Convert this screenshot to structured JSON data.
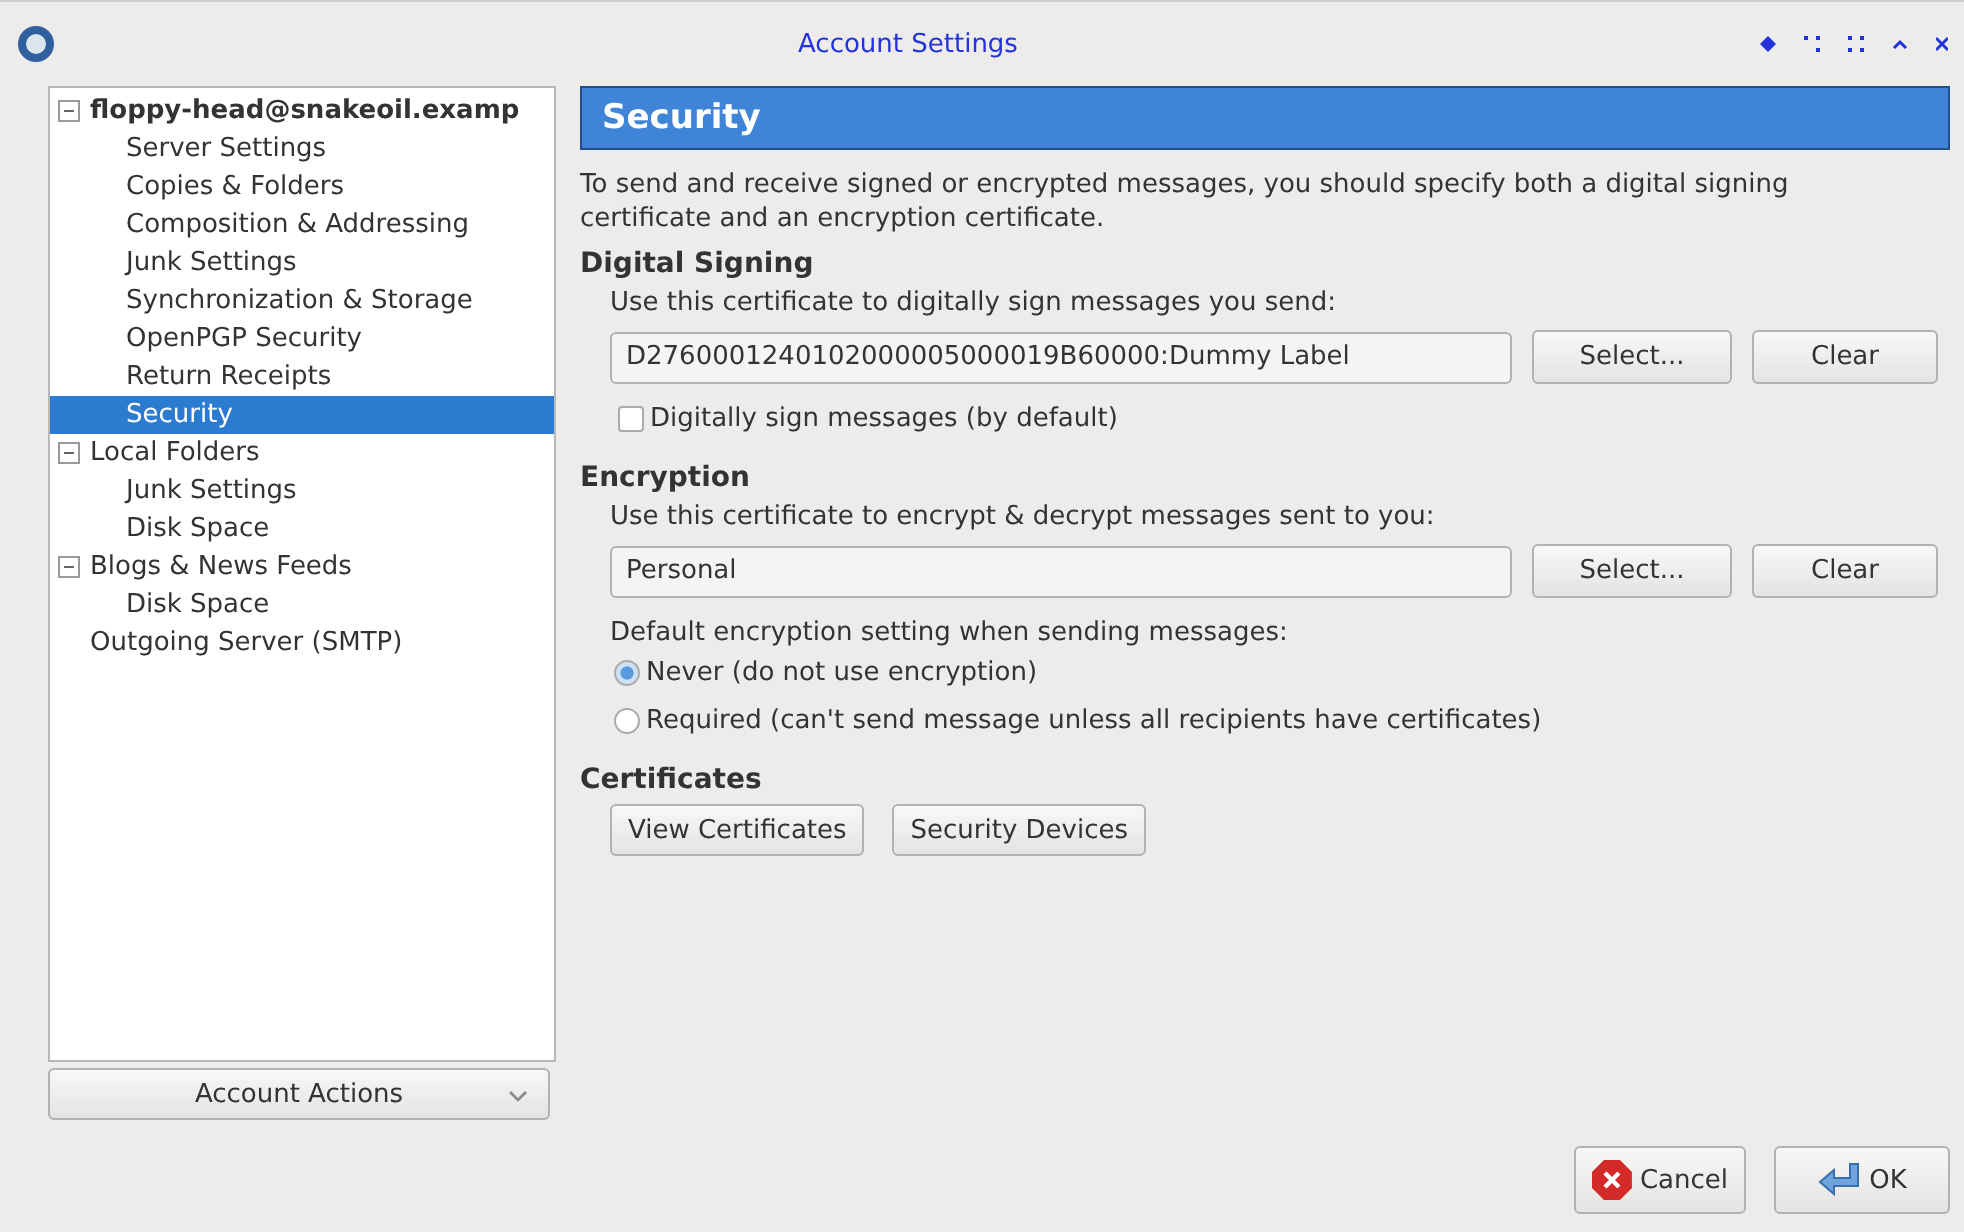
{
  "window": {
    "title": "Account Settings"
  },
  "tree": [
    {
      "label": "floppy-head@snakeoil.examp",
      "selected": false,
      "expanded": true,
      "bold": true,
      "children": [
        {
          "label": "Server Settings",
          "selected": false
        },
        {
          "label": "Copies & Folders",
          "selected": false
        },
        {
          "label": "Composition & Addressing",
          "selected": false
        },
        {
          "label": "Junk Settings",
          "selected": false
        },
        {
          "label": "Synchronization & Storage",
          "selected": false
        },
        {
          "label": "OpenPGP Security",
          "selected": false
        },
        {
          "label": "Return Receipts",
          "selected": false
        },
        {
          "label": "Security",
          "selected": true
        }
      ]
    },
    {
      "label": "Local Folders",
      "selected": false,
      "expanded": true,
      "children": [
        {
          "label": "Junk Settings",
          "selected": false
        },
        {
          "label": "Disk Space",
          "selected": false
        }
      ]
    },
    {
      "label": "Blogs & News Feeds",
      "selected": false,
      "expanded": true,
      "children": [
        {
          "label": "Disk Space",
          "selected": false
        }
      ]
    },
    {
      "label": "Outgoing Server (SMTP)",
      "selected": false
    }
  ],
  "account_actions": "Account Actions",
  "panel": {
    "title": "Security",
    "intro": "To send and receive signed or encrypted messages, you should specify both a digital signing certificate and an encryption certificate.",
    "signing": {
      "heading": "Digital Signing",
      "label": "Use this certificate to digitally sign messages you send:",
      "value": "D2760001240102000005000019B60000:Dummy Label",
      "select": "Select...",
      "clear": "Clear",
      "checkbox": {
        "label": "Digitally sign messages (by default)",
        "checked": false
      }
    },
    "encryption": {
      "heading": "Encryption",
      "label": "Use this certificate to encrypt & decrypt messages sent to you:",
      "value": "Personal",
      "select": "Select...",
      "clear": "Clear",
      "default_label": "Default encryption setting when sending messages:",
      "options": [
        {
          "label": "Never (do not use encryption)",
          "selected": true
        },
        {
          "label": "Required (can't send message unless all recipients have certificates)",
          "selected": false
        }
      ]
    },
    "certificates": {
      "heading": "Certificates",
      "buttons": [
        "View Certificates",
        "Security Devices"
      ]
    }
  },
  "buttons": [
    {
      "kind": "cancel",
      "label": "Cancel"
    },
    {
      "kind": "ok",
      "label": "OK"
    }
  ]
}
